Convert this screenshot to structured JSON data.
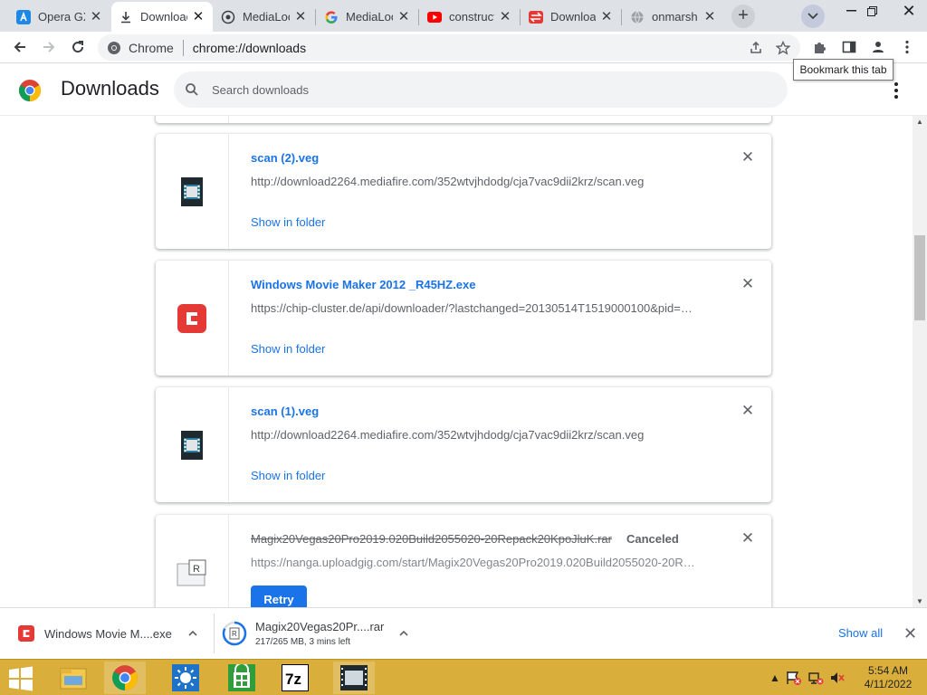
{
  "tabs": [
    {
      "label": "Opera GX",
      "icon": "app-store-icon",
      "active": false
    },
    {
      "label": "Downloads",
      "icon": "download-icon",
      "active": true
    },
    {
      "label": "MediaLoot",
      "icon": "medialoot-icon",
      "active": false
    },
    {
      "label": "MediaLoot",
      "icon": "google-icon",
      "active": false
    },
    {
      "label": "construct",
      "icon": "youtube-icon",
      "active": false
    },
    {
      "label": "Downloads",
      "icon": "red-download-icon",
      "active": false
    },
    {
      "label": "onmarsh",
      "icon": "globe-icon",
      "active": false
    }
  ],
  "toolbar": {
    "site_label": "Chrome",
    "url": "chrome://downloads",
    "tooltip": "Bookmark this tab"
  },
  "downloads_page": {
    "title": "Downloads",
    "search_placeholder": "Search downloads"
  },
  "downloads": [
    {
      "name": "scan (2).veg",
      "url": "http://download2264.mediafire.com/352wtvjhdodg/cja7vac9dii2krz/scan.veg",
      "action": "Show in folder",
      "icon": "film-file-icon",
      "status": ""
    },
    {
      "name": "Windows Movie Maker 2012 _R45HZ.exe",
      "url": "https://chip-cluster.de/api/downloader/?lastchanged=20130514T1519000100&pid=…",
      "action": "Show in folder",
      "icon": "chip-app-icon",
      "status": ""
    },
    {
      "name": "scan (1).veg",
      "url": "http://download2264.mediafire.com/352wtvjhdodg/cja7vac9dii2krz/scan.veg",
      "action": "Show in folder",
      "icon": "film-file-icon",
      "status": ""
    },
    {
      "name": "Magix20Vegas20Pro2019.020Build2055020-20Repack20KpoJluK.rar",
      "url": "https://nanga.uploadgig.com/start/Magix20Vegas20Pro2019.020Build2055020-20R…",
      "action": "Retry",
      "icon": "rar-file-icon",
      "status": "Canceled"
    }
  ],
  "shelf": {
    "items": [
      {
        "name": "Windows Movie M....exe",
        "sub": "",
        "icon": "chip-app-icon"
      },
      {
        "name": "Magix20Vegas20Pr....rar",
        "sub": "217/265 MB, 3 mins left",
        "icon": "rar-file-icon",
        "progress": 0.82
      }
    ],
    "show_all": "Show all"
  },
  "taskbar": {
    "time": "5:54 AM",
    "date": "4/11/2022",
    "apps": [
      "file-explorer-icon",
      "chrome-icon",
      "weather-icon",
      "store-icon",
      "7zip-icon",
      "video-editor-icon"
    ]
  },
  "colors": {
    "accent": "#1a73e8",
    "taskbar": "#d9ae3a",
    "tabstrip": "#dee1e6"
  }
}
